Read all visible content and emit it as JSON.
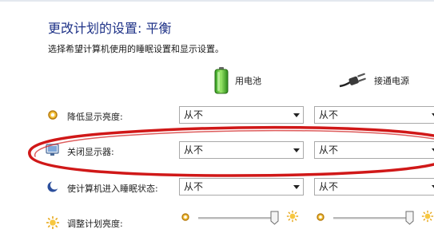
{
  "title": "更改计划的设置: 平衡",
  "subtitle": "选择希望计算机使用的睡眠设置和显示设置。",
  "columns": {
    "battery": {
      "label": "用电池",
      "icon": "battery-icon"
    },
    "plugged": {
      "label": "接通电源",
      "icon": "power-plug-icon"
    }
  },
  "rows": [
    {
      "label": "降低显示亮度:",
      "icon": "dim-display-icon",
      "battery_value": "从不",
      "plugged_value": "从不"
    },
    {
      "label": "关闭显示器:",
      "icon": "monitor-icon",
      "battery_value": "从不",
      "plugged_value": "从不"
    },
    {
      "label": "使计算机进入睡眠状态:",
      "icon": "sleep-moon-icon",
      "battery_value": "从不",
      "plugged_value": "从不"
    }
  ],
  "brightness": {
    "label": "调整计划亮度:",
    "icon": "brightness-sun-icon",
    "battery_level": 1.0,
    "plugged_level": 1.0
  },
  "colors": {
    "title": "#1e3287",
    "annotation_ellipse": "#d01818"
  }
}
